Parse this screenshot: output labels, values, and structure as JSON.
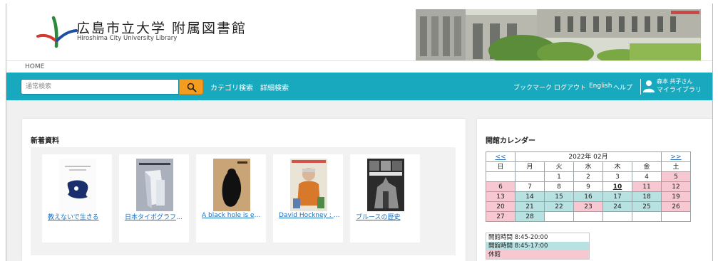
{
  "header": {
    "library_name_ja": "広島市立大学 附属図書館",
    "library_name_en": "Hiroshima City University Library"
  },
  "breadcrumb": {
    "home": "HOME"
  },
  "search": {
    "placeholder": "通常検索",
    "category_search": "カテゴリ検索",
    "advanced_search": "詳細検索"
  },
  "top_nav": {
    "bookmark": "ブックマーク",
    "logout": "ログアウト",
    "english": "English",
    "help": "ヘルプ",
    "user_name": "森本 共子さん",
    "my_library": "マイライブラリ"
  },
  "new_materials": {
    "title": "新着資料",
    "books": [
      {
        "title": "教えないで生きる"
      },
      {
        "title": "日本タイポグラフィ…"
      },
      {
        "title": "A black hole is ever…"
      },
      {
        "title": "David Hockney : a c…"
      },
      {
        "title": "ブルースの歴史"
      }
    ]
  },
  "calendar": {
    "title": "開館カレンダー",
    "prev": "<<",
    "next": ">>",
    "month_label": "2022年 02月",
    "weekdays": [
      "日",
      "月",
      "火",
      "水",
      "木",
      "金",
      "土"
    ],
    "colors": {
      "open_long": "#ffffff",
      "open_short": "#b8e1e2",
      "closed": "#f7c7d2"
    },
    "weeks": [
      [
        {
          "d": "",
          "s": "e"
        },
        {
          "d": "",
          "s": "e"
        },
        {
          "d": "1",
          "s": "w"
        },
        {
          "d": "2",
          "s": "w"
        },
        {
          "d": "3",
          "s": "w"
        },
        {
          "d": "4",
          "s": "w"
        },
        {
          "d": "5",
          "s": "p"
        }
      ],
      [
        {
          "d": "6",
          "s": "p"
        },
        {
          "d": "7",
          "s": "w"
        },
        {
          "d": "8",
          "s": "w"
        },
        {
          "d": "9",
          "s": "w"
        },
        {
          "d": "10",
          "s": "t"
        },
        {
          "d": "11",
          "s": "p"
        },
        {
          "d": "12",
          "s": "p"
        }
      ],
      [
        {
          "d": "13",
          "s": "p"
        },
        {
          "d": "14",
          "s": "b"
        },
        {
          "d": "15",
          "s": "b"
        },
        {
          "d": "16",
          "s": "b"
        },
        {
          "d": "17",
          "s": "b"
        },
        {
          "d": "18",
          "s": "b"
        },
        {
          "d": "19",
          "s": "p"
        }
      ],
      [
        {
          "d": "20",
          "s": "p"
        },
        {
          "d": "21",
          "s": "b"
        },
        {
          "d": "22",
          "s": "b"
        },
        {
          "d": "23",
          "s": "p"
        },
        {
          "d": "24",
          "s": "b"
        },
        {
          "d": "25",
          "s": "b"
        },
        {
          "d": "26",
          "s": "p"
        }
      ],
      [
        {
          "d": "27",
          "s": "p"
        },
        {
          "d": "28",
          "s": "b"
        },
        {
          "d": "",
          "s": "e"
        },
        {
          "d": "",
          "s": "e"
        },
        {
          "d": "",
          "s": "e"
        },
        {
          "d": "",
          "s": "e"
        },
        {
          "d": "",
          "s": "e"
        }
      ]
    ],
    "legend": {
      "hours_long": "開館時間 8:45-20:00",
      "hours_short": "開館時間 8:45-17:00",
      "closed": "休館"
    }
  }
}
